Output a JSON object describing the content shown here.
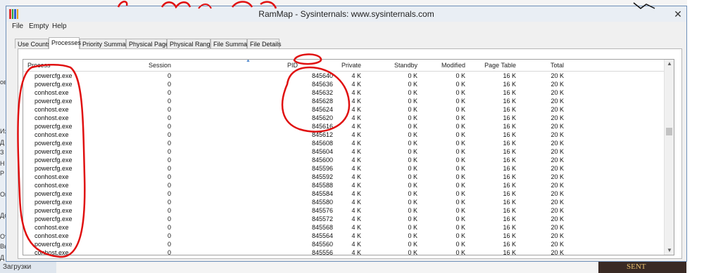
{
  "window": {
    "title": "RamMap - Sysinternals: www.sysinternals.com",
    "close_glyph": "✕"
  },
  "menu": [
    "File",
    "Empty",
    "Help"
  ],
  "tabs": [
    "Use Counts",
    "Processes",
    "Priority Summary",
    "Physical Pages",
    "Physical Ranges",
    "File Summary",
    "File Details"
  ],
  "active_tab": "Processes",
  "columns": [
    "Process",
    "Session",
    "PID",
    "Private",
    "Standby",
    "Modified",
    "Page Table",
    "Total"
  ],
  "rows": [
    [
      "powercfg.exe",
      "0",
      "845640",
      "4 K",
      "0 K",
      "0 K",
      "16 K",
      "20 K"
    ],
    [
      "powercfg.exe",
      "0",
      "845636",
      "4 K",
      "0 K",
      "0 K",
      "16 K",
      "20 K"
    ],
    [
      "conhost.exe",
      "0",
      "845632",
      "4 K",
      "0 K",
      "0 K",
      "16 K",
      "20 K"
    ],
    [
      "powercfg.exe",
      "0",
      "845628",
      "4 K",
      "0 K",
      "0 K",
      "16 K",
      "20 K"
    ],
    [
      "conhost.exe",
      "0",
      "845624",
      "4 K",
      "0 K",
      "0 K",
      "16 K",
      "20 K"
    ],
    [
      "conhost.exe",
      "0",
      "845620",
      "4 K",
      "0 K",
      "0 K",
      "16 K",
      "20 K"
    ],
    [
      "powercfg.exe",
      "0",
      "845616",
      "4 K",
      "0 K",
      "0 K",
      "16 K",
      "20 K"
    ],
    [
      "conhost.exe",
      "0",
      "845612",
      "4 K",
      "0 K",
      "0 K",
      "16 K",
      "20 K"
    ],
    [
      "powercfg.exe",
      "0",
      "845608",
      "4 K",
      "0 K",
      "0 K",
      "16 K",
      "20 K"
    ],
    [
      "powercfg.exe",
      "0",
      "845604",
      "4 K",
      "0 K",
      "0 K",
      "16 K",
      "20 K"
    ],
    [
      "powercfg.exe",
      "0",
      "845600",
      "4 K",
      "0 K",
      "0 K",
      "16 K",
      "20 K"
    ],
    [
      "powercfg.exe",
      "0",
      "845596",
      "4 K",
      "0 K",
      "0 K",
      "16 K",
      "20 K"
    ],
    [
      "conhost.exe",
      "0",
      "845592",
      "4 K",
      "0 K",
      "0 K",
      "16 K",
      "20 K"
    ],
    [
      "conhost.exe",
      "0",
      "845588",
      "4 K",
      "0 K",
      "0 K",
      "16 K",
      "20 K"
    ],
    [
      "powercfg.exe",
      "0",
      "845584",
      "4 K",
      "0 K",
      "0 K",
      "16 K",
      "20 K"
    ],
    [
      "powercfg.exe",
      "0",
      "845580",
      "4 K",
      "0 K",
      "0 K",
      "16 K",
      "20 K"
    ],
    [
      "powercfg.exe",
      "0",
      "845576",
      "4 K",
      "0 K",
      "0 K",
      "16 K",
      "20 K"
    ],
    [
      "powercfg.exe",
      "0",
      "845572",
      "4 K",
      "0 K",
      "0 K",
      "16 K",
      "20 K"
    ],
    [
      "conhost.exe",
      "0",
      "845568",
      "4 K",
      "0 K",
      "0 K",
      "16 K",
      "20 K"
    ],
    [
      "conhost.exe",
      "0",
      "845564",
      "4 K",
      "0 K",
      "0 K",
      "16 K",
      "20 K"
    ],
    [
      "powercfg.exe",
      "0",
      "845560",
      "4 K",
      "0 K",
      "0 K",
      "16 K",
      "20 K"
    ],
    [
      "conhost.exe",
      "0",
      "845556",
      "4 K",
      "0 K",
      "0 K",
      "16 K",
      "20 K"
    ]
  ],
  "background": {
    "left_fragments": [
      "ова",
      "Изм",
      "Д",
      "З",
      "Н",
      "Р",
      "Оп",
      "До",
      "Ото",
      "Вь",
      "Д",
      "Загрузки"
    ],
    "bottom_right_text": "SENT"
  },
  "colors": {
    "annotation_red": "#e01010",
    "window_border": "#6e8fb8",
    "app_icon": [
      "#e03030",
      "#30a030",
      "#3060d0",
      "#e0a020"
    ]
  }
}
